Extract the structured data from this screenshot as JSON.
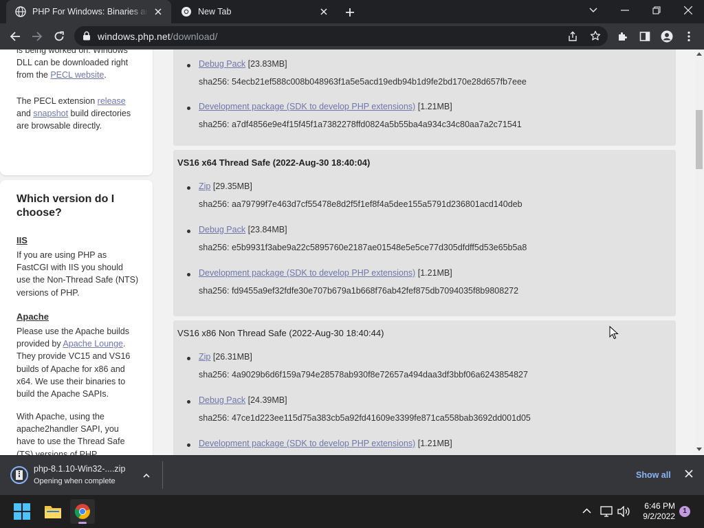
{
  "browser": {
    "tabs": [
      {
        "title": "PHP For Windows: Binaries and source Releases"
      },
      {
        "title": "New Tab"
      }
    ],
    "url_host": "windows.php.net",
    "url_path": "/download/"
  },
  "sidebar": {
    "pecl_box": {
      "p1_text_a": "is being worked on. Windows DLL can be downloaded right from the ",
      "p1_link": "PECL website",
      "p1_text_b": ".",
      "p2_text_a": "The PECL extension ",
      "p2_link1": "release",
      "p2_text_b": " and ",
      "p2_link2": "snapshot",
      "p2_text_c": " build directories are browsable directly."
    },
    "version_box": {
      "title": "Which version do I choose?",
      "iis_heading": "IIS",
      "iis_text": "If you are using PHP as FastCGI with IIS you should use the Non-Thread Safe (NTS) versions of PHP.",
      "apache_heading": "Apache",
      "apache_text_a": "Please use the Apache builds provided by ",
      "apache_link": "Apache Lounge",
      "apache_text_b": ". They provide VC15 and VS16 builds of Apache for x86 and x64. We use their binaries to build the Apache SAPIs.",
      "apache_text_c": "With Apache, using the apache2handler SAPI, you have to use the Thread Safe (TS) versions of PHP."
    }
  },
  "builds": [
    {
      "heading": "",
      "files": [
        {
          "link": "Debug Pack",
          "size": "[23.83MB]",
          "sha": "sha256: 54ecb21ef588c008b048963f1a5e5acd19edb94b1d9fe2bd170e28d657fb7eee"
        },
        {
          "link": "Development package (SDK to develop PHP extensions)",
          "size": "[1.21MB]",
          "sha": "sha256: a7df4856e9e4f15f45f1a7382278ffd0824a5b55ba4a934c34c80aa7a2c71541"
        }
      ]
    },
    {
      "heading": "VS16 x64 Thread Safe (2022-Aug-30 18:40:04)",
      "files": [
        {
          "link": "Zip",
          "size": "[29.35MB]",
          "sha": "sha256: aa79799f7e463d7cf55478e8d2f5f1ef8f4a5dee155a5791d236801acd140deb"
        },
        {
          "link": "Debug Pack",
          "size": "[23.84MB]",
          "sha": "sha256: e5b9931f3abe9a22c5895760e2187ae01548e5e5ce77d305dfdff5d53e65b5a8"
        },
        {
          "link": "Development package (SDK to develop PHP extensions)",
          "size": "[1.21MB]",
          "sha": "sha256: fd9455a9ef32fdfe30e707b679a1b668f76ab42fef875db7094035f8b9808272"
        }
      ]
    },
    {
      "heading": "VS16 x86 Non Thread Safe (2022-Aug-30 18:40:44)",
      "files": [
        {
          "link": "Zip",
          "size": "[26.31MB]",
          "sha": "sha256: 4a9029b6d6f159a794e28578ab930f8e72657a494daa3df3bbf06a6243854827"
        },
        {
          "link": "Debug Pack",
          "size": "[24.39MB]",
          "sha": "sha256: 47ce1d223ee115d75a383cb5a92fd41609e3399fe871ca558bab3692dd001d05"
        },
        {
          "link": "Development package (SDK to develop PHP extensions)",
          "size": "[1.21MB]",
          "sha": ""
        }
      ]
    }
  ],
  "download_bar": {
    "filename": "php-8.1.10-Win32-....zip",
    "status": "Opening when complete",
    "show_all": "Show all"
  },
  "taskbar": {
    "time": "6:46 PM",
    "date": "9/2/2022",
    "notification_count": "1"
  },
  "colors": {
    "link": "#6e76aa",
    "chrome_dark": "#202124",
    "toolbar": "#35363a",
    "build_bg": "#e2e2e2",
    "show_all": "#8ab4f8"
  }
}
